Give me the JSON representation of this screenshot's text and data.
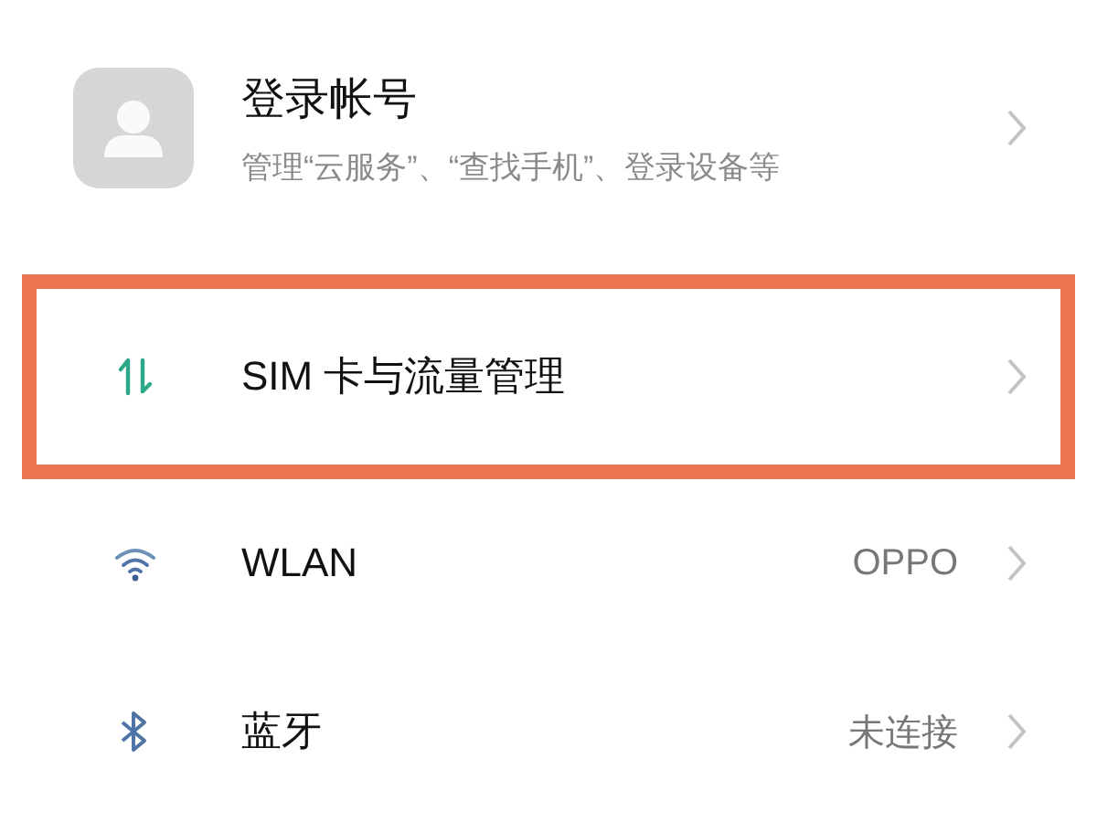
{
  "account": {
    "title": "登录帐号",
    "subtitle": "管理“云服务”、“查找手机”、登录设备等"
  },
  "items": [
    {
      "kind": "sim",
      "label": "SIM 卡与流量管理",
      "highlighted": true
    },
    {
      "kind": "wlan",
      "label": "WLAN",
      "value": "OPPO",
      "highlighted": false
    },
    {
      "kind": "bluetooth",
      "label": "蓝牙",
      "value": "未连接",
      "highlighted": false
    }
  ]
}
